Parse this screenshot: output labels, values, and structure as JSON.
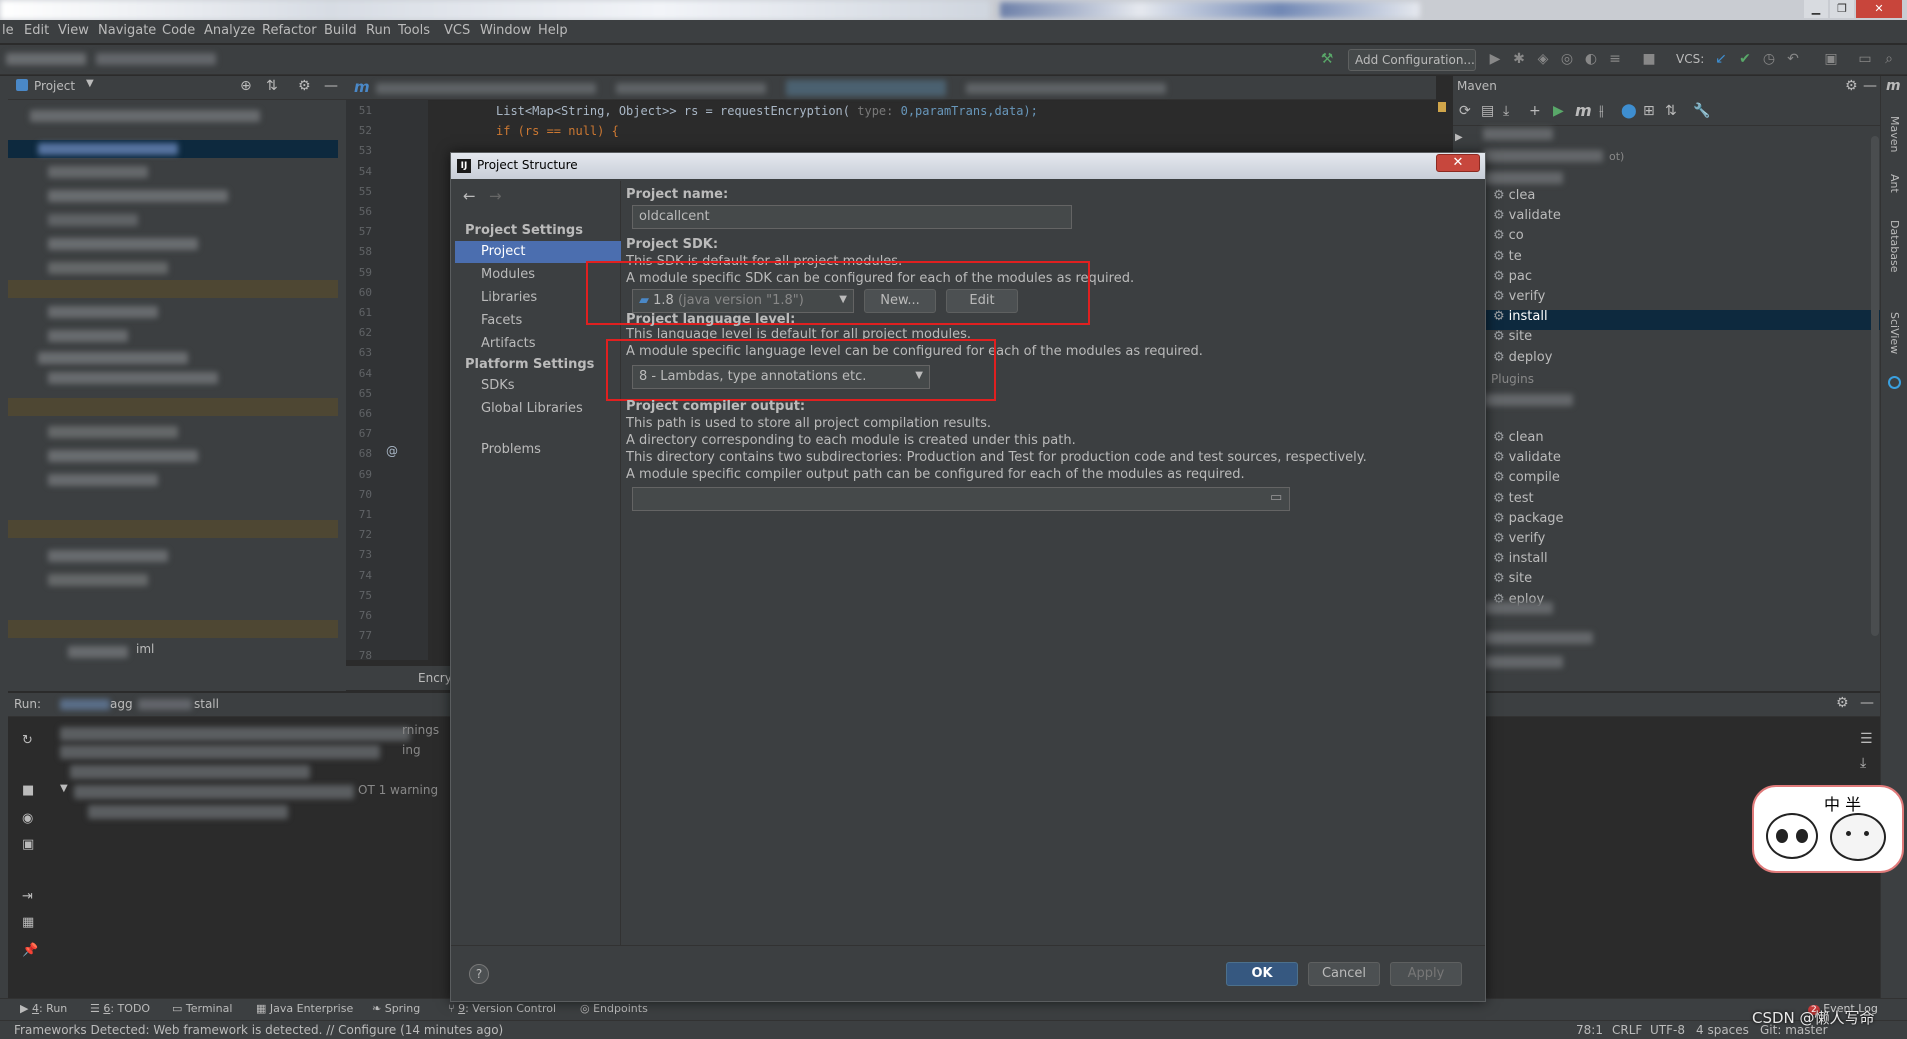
{
  "menu": [
    "le",
    "Edit",
    "View",
    "Navigate",
    "Code",
    "Analyze",
    "Refactor",
    "Build",
    "Run",
    "Tools",
    "VCS",
    "Window",
    "Help"
  ],
  "toolbar": {
    "add_configuration": "Add Configuration...",
    "vcs_label": "VCS:"
  },
  "project_panel": {
    "title": "Project"
  },
  "editor": {
    "tab_m": "m",
    "line_numbers": [
      "51",
      "52",
      "53",
      "54",
      "55",
      "56",
      "57",
      "58",
      "59",
      "60",
      "61",
      "62",
      "63",
      "64",
      "65",
      "66",
      "67",
      "68",
      "69",
      "70",
      "71",
      "72",
      "73",
      "74",
      "75",
      "76",
      "77",
      "78"
    ],
    "code_line_52": "List<Map<String, Object>> rs = requestEncryption(",
    "code_hint": "type:",
    "code_line_52_rest": "0,paramTrans,data);",
    "code_line_53": "if (rs == null) {",
    "breadcrumb": "Encry"
  },
  "maven": {
    "title": "Maven",
    "lifecycle_partial": [
      "clea",
      "validate",
      "co",
      "te",
      "pac",
      "verify",
      "install",
      "site",
      "deploy"
    ],
    "plugins_label": "Plugins",
    "lifecycle": [
      "clean",
      "validate",
      "compile",
      "test",
      "package",
      "verify",
      "install",
      "site",
      "eploy"
    ],
    "root_suffix": "ot)"
  },
  "right_strip": [
    "Maven",
    "Ant",
    "Database",
    "SciView"
  ],
  "run_panel": {
    "label": "Run:",
    "config_a": "agg",
    "config_b": "stall",
    "warnings_a": "rnings",
    "warnings_b": "ing",
    "warning_line": "OT  1 warning",
    "iml": "iml"
  },
  "dialog": {
    "title": "Project Structure",
    "close": "✕",
    "nav_back": "←",
    "nav_fwd": "→",
    "project_settings": "Project Settings",
    "project_settings_items": [
      "Project",
      "Modules",
      "Libraries",
      "Facets",
      "Artifacts"
    ],
    "platform_settings": "Platform Settings",
    "platform_settings_items": [
      "SDKs",
      "Global Libraries"
    ],
    "problems": "Problems",
    "project_name_label": "Project name:",
    "project_name_value": "oldcallcent",
    "sdk_label": "Project SDK:",
    "sdk_desc1": "This SDK is default for all project modules.",
    "sdk_desc2": "A module specific SDK can be configured for each of the modules as required.",
    "sdk_value": "1.8",
    "sdk_version": "(java version \"1.8\")",
    "new_button": "New...",
    "edit_button": "Edit",
    "lang_label": "Project language level:",
    "lang_desc1": "This language level is default for all project modules.",
    "lang_desc2": "A module specific language level can be configured for each of the modules as required.",
    "lang_value": "8 - Lambdas, type annotations etc.",
    "compiler_label": "Project compiler output:",
    "compiler_desc1": "This path is used to store all project compilation results.",
    "compiler_desc2": "A directory corresponding to each module is created under this path.",
    "compiler_desc3": "This directory contains two subdirectories: Production and Test for production code and test sources, respectively.",
    "compiler_desc4": "A module specific compiler output path can be configured for each of the modules as required.",
    "compiler_value": "",
    "help": "?",
    "ok": "OK",
    "cancel": "Cancel",
    "apply": "Apply"
  },
  "bottom_tabs": [
    {
      "num": "4",
      "label": ": Run"
    },
    {
      "num": "6",
      "label": ": TODO"
    },
    {
      "num": "",
      "label": "Terminal"
    },
    {
      "num": "",
      "label": "Java Enterprise"
    },
    {
      "num": "",
      "label": "Spring"
    },
    {
      "num": "9",
      "label": ": Version Control"
    },
    {
      "num": "",
      "label": "Endpoints"
    }
  ],
  "status": {
    "message": "Frameworks Detected: Web framework is detected. // Configure (14 minutes ago)",
    "position": "78:1",
    "line_sep": "CRLF",
    "encoding": "UTF-8",
    "indent": "4 spaces",
    "git": "Git: master",
    "event_log": "Event Log",
    "event_count": "2",
    "watermark": "CSDN @懒人写命"
  },
  "sticker": {
    "text": "中  半"
  }
}
